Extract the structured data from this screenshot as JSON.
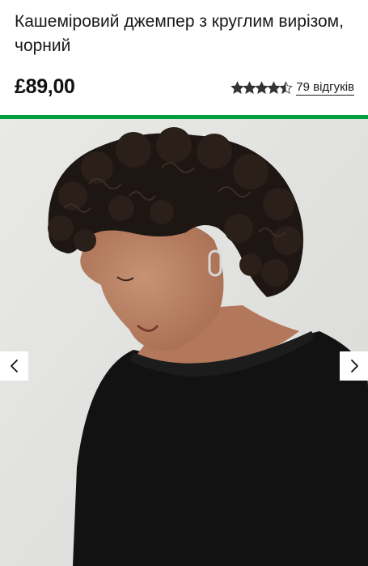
{
  "product": {
    "title": "Кашеміровий джемпер з круглим вирізом, чорний",
    "price": "£89,00"
  },
  "rating": {
    "value": 4.5,
    "max": 5,
    "reviews_label": "79 відгуків",
    "star_color": "#333333"
  },
  "accent_color": "#00a03a",
  "gallery": {
    "image_icon": "product-photo",
    "prev_icon": "chevron-left-icon",
    "next_icon": "chevron-right-icon"
  }
}
